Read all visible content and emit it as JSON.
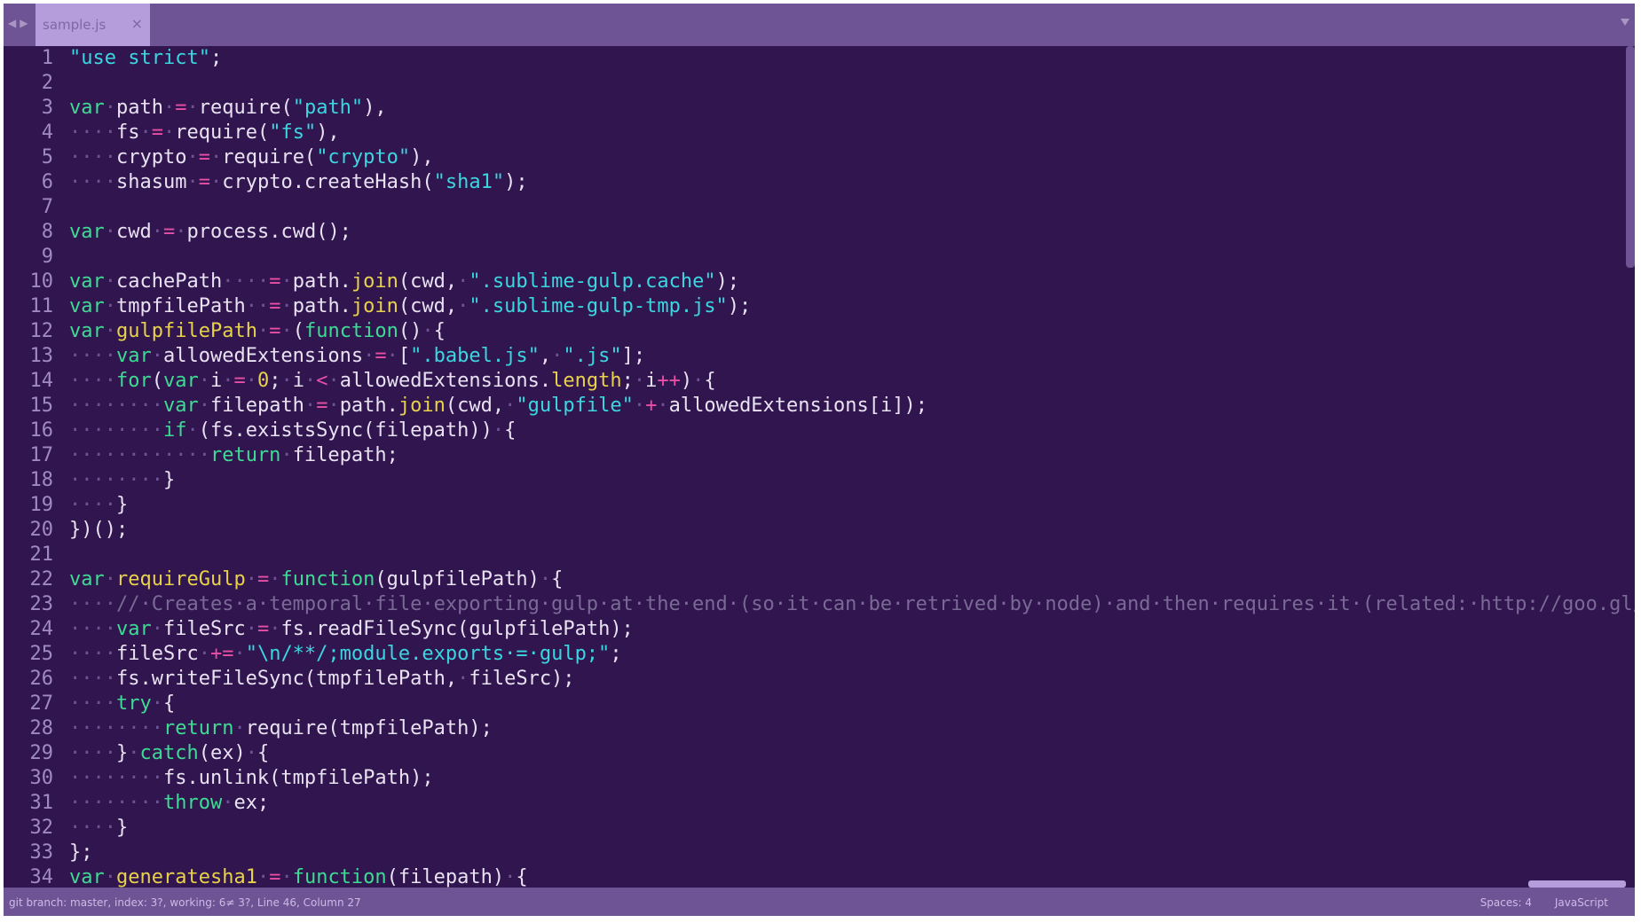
{
  "colors": {
    "background": "#31154f",
    "tabbar": "#6e5494",
    "active_tab": "#b59cdb",
    "text": "#e8e2f2",
    "keyword": "#3ddb93",
    "string": "#3bd6e0",
    "number": "#e8d24a",
    "operator": "#e94fa6",
    "function": "#e8d24a",
    "comment": "#7a6a96",
    "whitespace_dots": "#6e5494",
    "line_number": "#9f8bc0"
  },
  "tab": {
    "title": "sample.js",
    "close_glyph": "×"
  },
  "icons": {
    "nav": "nav-arrows-icon",
    "close": "close-icon",
    "dropdown": "dropdown-icon"
  },
  "editor": {
    "language": "JavaScript",
    "lines": [
      [
        [
          "s",
          "\"use strict\""
        ],
        [
          "t",
          ";"
        ]
      ],
      [],
      [
        [
          "k",
          "var"
        ],
        [
          "w",
          "·"
        ],
        [
          "t",
          "path"
        ],
        [
          "w",
          "·"
        ],
        [
          "o",
          "="
        ],
        [
          "w",
          "·"
        ],
        [
          "t",
          "require("
        ],
        [
          "s",
          "\"path\""
        ],
        [
          "t",
          "),"
        ]
      ],
      [
        [
          "w",
          "····"
        ],
        [
          "t",
          "fs"
        ],
        [
          "w",
          "·"
        ],
        [
          "o",
          "="
        ],
        [
          "w",
          "·"
        ],
        [
          "t",
          "require("
        ],
        [
          "s",
          "\"fs\""
        ],
        [
          "t",
          "),"
        ]
      ],
      [
        [
          "w",
          "····"
        ],
        [
          "t",
          "crypto"
        ],
        [
          "w",
          "·"
        ],
        [
          "o",
          "="
        ],
        [
          "w",
          "·"
        ],
        [
          "t",
          "require("
        ],
        [
          "s",
          "\"crypto\""
        ],
        [
          "t",
          "),"
        ]
      ],
      [
        [
          "w",
          "····"
        ],
        [
          "t",
          "shasum"
        ],
        [
          "w",
          "·"
        ],
        [
          "o",
          "="
        ],
        [
          "w",
          "·"
        ],
        [
          "t",
          "crypto.createHash("
        ],
        [
          "s",
          "\"sha1\""
        ],
        [
          "t",
          ");"
        ]
      ],
      [],
      [
        [
          "k",
          "var"
        ],
        [
          "w",
          "·"
        ],
        [
          "t",
          "cwd"
        ],
        [
          "w",
          "·"
        ],
        [
          "o",
          "="
        ],
        [
          "w",
          "·"
        ],
        [
          "t",
          "process.cwd();"
        ]
      ],
      [],
      [
        [
          "k",
          "var"
        ],
        [
          "w",
          "·"
        ],
        [
          "t",
          "cachePath"
        ],
        [
          "w",
          "····"
        ],
        [
          "o",
          "="
        ],
        [
          "w",
          "·"
        ],
        [
          "t",
          "path."
        ],
        [
          "f",
          "join"
        ],
        [
          "t",
          "(cwd,"
        ],
        [
          "w",
          "·"
        ],
        [
          "s",
          "\".sublime-gulp.cache\""
        ],
        [
          "t",
          ");"
        ]
      ],
      [
        [
          "k",
          "var"
        ],
        [
          "w",
          "·"
        ],
        [
          "t",
          "tmpfilePath"
        ],
        [
          "w",
          "··"
        ],
        [
          "o",
          "="
        ],
        [
          "w",
          "·"
        ],
        [
          "t",
          "path."
        ],
        [
          "f",
          "join"
        ],
        [
          "t",
          "(cwd,"
        ],
        [
          "w",
          "·"
        ],
        [
          "s",
          "\".sublime-gulp-tmp.js\""
        ],
        [
          "t",
          ");"
        ]
      ],
      [
        [
          "k",
          "var"
        ],
        [
          "w",
          "·"
        ],
        [
          "f",
          "gulpfilePath"
        ],
        [
          "w",
          "·"
        ],
        [
          "o",
          "="
        ],
        [
          "w",
          "·"
        ],
        [
          "t",
          "("
        ],
        [
          "k",
          "function"
        ],
        [
          "t",
          "()"
        ],
        [
          "w",
          "·"
        ],
        [
          "t",
          "{"
        ]
      ],
      [
        [
          "w",
          "····"
        ],
        [
          "k",
          "var"
        ],
        [
          "w",
          "·"
        ],
        [
          "t",
          "allowedExtensions"
        ],
        [
          "w",
          "·"
        ],
        [
          "o",
          "="
        ],
        [
          "w",
          "·"
        ],
        [
          "t",
          "["
        ],
        [
          "s",
          "\".babel.js\""
        ],
        [
          "t",
          ","
        ],
        [
          "w",
          "·"
        ],
        [
          "s",
          "\".js\""
        ],
        [
          "t",
          "];"
        ]
      ],
      [
        [
          "w",
          "····"
        ],
        [
          "k",
          "for"
        ],
        [
          "t",
          "("
        ],
        [
          "k",
          "var"
        ],
        [
          "w",
          "·"
        ],
        [
          "t",
          "i"
        ],
        [
          "w",
          "·"
        ],
        [
          "o",
          "="
        ],
        [
          "w",
          "·"
        ],
        [
          "n",
          "0"
        ],
        [
          "t",
          ";"
        ],
        [
          "w",
          "·"
        ],
        [
          "t",
          "i"
        ],
        [
          "w",
          "·"
        ],
        [
          "o",
          "<"
        ],
        [
          "w",
          "·"
        ],
        [
          "t",
          "allowedExtensions."
        ],
        [
          "f",
          "length"
        ],
        [
          "t",
          ";"
        ],
        [
          "w",
          "·"
        ],
        [
          "t",
          "i"
        ],
        [
          "o",
          "++"
        ],
        [
          "t",
          ")"
        ],
        [
          "w",
          "·"
        ],
        [
          "t",
          "{"
        ]
      ],
      [
        [
          "w",
          "········"
        ],
        [
          "k",
          "var"
        ],
        [
          "w",
          "·"
        ],
        [
          "t",
          "filepath"
        ],
        [
          "w",
          "·"
        ],
        [
          "o",
          "="
        ],
        [
          "w",
          "·"
        ],
        [
          "t",
          "path."
        ],
        [
          "f",
          "join"
        ],
        [
          "t",
          "(cwd,"
        ],
        [
          "w",
          "·"
        ],
        [
          "s",
          "\"gulpfile\""
        ],
        [
          "w",
          "·"
        ],
        [
          "o",
          "+"
        ],
        [
          "w",
          "·"
        ],
        [
          "t",
          "allowedExtensions[i]);"
        ]
      ],
      [
        [
          "w",
          "········"
        ],
        [
          "k",
          "if"
        ],
        [
          "w",
          "·"
        ],
        [
          "t",
          "(fs.existsSync(filepath))"
        ],
        [
          "w",
          "·"
        ],
        [
          "t",
          "{"
        ]
      ],
      [
        [
          "w",
          "············"
        ],
        [
          "k",
          "return"
        ],
        [
          "w",
          "·"
        ],
        [
          "t",
          "filepath;"
        ]
      ],
      [
        [
          "w",
          "········"
        ],
        [
          "t",
          "}"
        ]
      ],
      [
        [
          "w",
          "····"
        ],
        [
          "t",
          "}"
        ]
      ],
      [
        [
          "t",
          "})();"
        ]
      ],
      [],
      [
        [
          "k",
          "var"
        ],
        [
          "w",
          "·"
        ],
        [
          "f",
          "requireGulp"
        ],
        [
          "w",
          "·"
        ],
        [
          "o",
          "="
        ],
        [
          "w",
          "·"
        ],
        [
          "k",
          "function"
        ],
        [
          "t",
          "(gulpfilePath)"
        ],
        [
          "w",
          "·"
        ],
        [
          "t",
          "{"
        ]
      ],
      [
        [
          "w",
          "····"
        ],
        [
          "c",
          "//·Creates·a·temporal·file·exporting·gulp·at·the·end·(so·it·can·be·retrived·by·node)·and·then·requires·it·(related:·http://goo.gl/QJ"
        ]
      ],
      [
        [
          "w",
          "····"
        ],
        [
          "k",
          "var"
        ],
        [
          "w",
          "·"
        ],
        [
          "t",
          "fileSrc"
        ],
        [
          "w",
          "·"
        ],
        [
          "o",
          "="
        ],
        [
          "w",
          "·"
        ],
        [
          "t",
          "fs.readFileSync(gulpfilePath);"
        ]
      ],
      [
        [
          "w",
          "····"
        ],
        [
          "t",
          "fileSrc"
        ],
        [
          "w",
          "·"
        ],
        [
          "o",
          "+="
        ],
        [
          "w",
          "·"
        ],
        [
          "s",
          "\"\\n/**/;module.exports·=·gulp;\""
        ],
        [
          "t",
          ";"
        ]
      ],
      [
        [
          "w",
          "····"
        ],
        [
          "t",
          "fs.writeFileSync(tmpfilePath,"
        ],
        [
          "w",
          "·"
        ],
        [
          "t",
          "fileSrc);"
        ]
      ],
      [
        [
          "w",
          "····"
        ],
        [
          "k",
          "try"
        ],
        [
          "w",
          "·"
        ],
        [
          "t",
          "{"
        ]
      ],
      [
        [
          "w",
          "········"
        ],
        [
          "k",
          "return"
        ],
        [
          "w",
          "·"
        ],
        [
          "t",
          "require(tmpfilePath);"
        ]
      ],
      [
        [
          "w",
          "····"
        ],
        [
          "t",
          "}"
        ],
        [
          "w",
          "·"
        ],
        [
          "k",
          "catch"
        ],
        [
          "t",
          "(ex)"
        ],
        [
          "w",
          "·"
        ],
        [
          "t",
          "{"
        ]
      ],
      [
        [
          "w",
          "········"
        ],
        [
          "t",
          "fs.unlink(tmpfilePath);"
        ]
      ],
      [
        [
          "w",
          "········"
        ],
        [
          "k",
          "throw"
        ],
        [
          "w",
          "·"
        ],
        [
          "t",
          "ex;"
        ]
      ],
      [
        [
          "w",
          "····"
        ],
        [
          "t",
          "}"
        ]
      ],
      [
        [
          "t",
          "};"
        ]
      ],
      [
        [
          "k",
          "var"
        ],
        [
          "w",
          "·"
        ],
        [
          "f",
          "generatesha1"
        ],
        [
          "w",
          "·"
        ],
        [
          "o",
          "="
        ],
        [
          "w",
          "·"
        ],
        [
          "k",
          "function"
        ],
        [
          "t",
          "(filepath)"
        ],
        [
          "w",
          "·"
        ],
        [
          "t",
          "{"
        ]
      ]
    ]
  },
  "status": {
    "left": "git branch: master, index: 3?, working: 6≠ 3?, Line 46, Column 27",
    "indentation": "Spaces: 4",
    "syntax": "JavaScript"
  }
}
